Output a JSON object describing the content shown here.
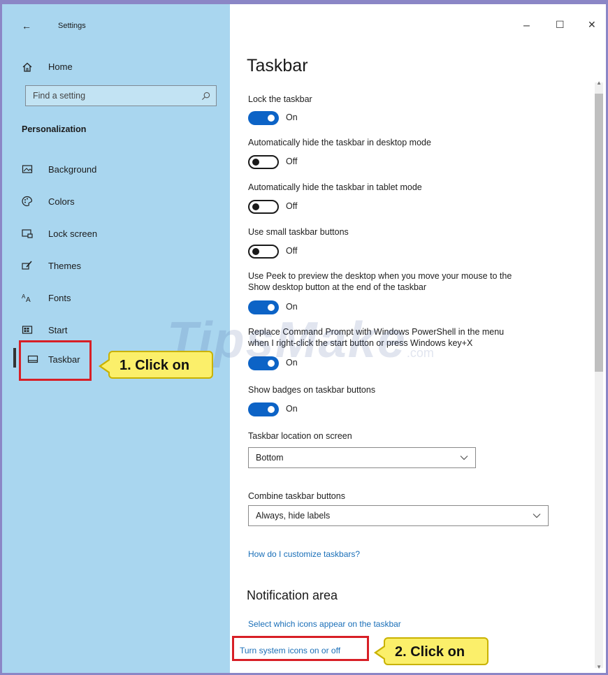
{
  "window": {
    "title": "Settings",
    "back_glyph": "←",
    "minimize_glyph": "–",
    "maximize_glyph": "☐",
    "close_glyph": "✕"
  },
  "sidebar": {
    "home_label": "Home",
    "search_placeholder": "Find a setting",
    "section_title": "Personalization",
    "items": [
      {
        "label": "Background",
        "icon": "picture-icon"
      },
      {
        "label": "Colors",
        "icon": "palette-icon"
      },
      {
        "label": "Lock screen",
        "icon": "lock-screen-icon"
      },
      {
        "label": "Themes",
        "icon": "brush-icon"
      },
      {
        "label": "Fonts",
        "icon": "font-icon"
      },
      {
        "label": "Start",
        "icon": "start-icon"
      },
      {
        "label": "Taskbar",
        "icon": "taskbar-icon",
        "selected": true
      }
    ]
  },
  "main": {
    "title": "Taskbar",
    "settings": [
      {
        "label": "Lock the taskbar",
        "state": "On"
      },
      {
        "label": "Automatically hide the taskbar in desktop mode",
        "state": "Off"
      },
      {
        "label": "Automatically hide the taskbar in tablet mode",
        "state": "Off"
      },
      {
        "label": "Use small taskbar buttons",
        "state": "Off"
      },
      {
        "label_line1": "Use Peek to preview the desktop when you move your mouse to the",
        "label_line2": "Show desktop button at the end of the taskbar",
        "state": "On"
      },
      {
        "label_line1": "Replace Command Prompt with Windows PowerShell in the menu",
        "label_line2": "when I right-click the start button or press Windows key+X",
        "state": "On"
      },
      {
        "label": "Show badges on taskbar buttons",
        "state": "On"
      }
    ],
    "location_label": "Taskbar location on screen",
    "location_value": "Bottom",
    "combine_label": "Combine taskbar buttons",
    "combine_value": "Always, hide labels",
    "help_link": "How do I customize taskbars?",
    "notification_title": "Notification area",
    "notification_link1": "Select which icons appear on the taskbar",
    "notification_link2": "Turn system icons on or off"
  },
  "annotations": {
    "callout1": "1. Click on",
    "callout2": "2. Click on",
    "callout_color": "#fbef6a",
    "highlight_color": "#d81f26"
  },
  "watermark": {
    "text": "TipsMake",
    "suffix": ".com"
  },
  "colors": {
    "sidebar_bg": "#a9d6ef",
    "toggle_on": "#0c63c6",
    "link": "#1a6fb8"
  }
}
